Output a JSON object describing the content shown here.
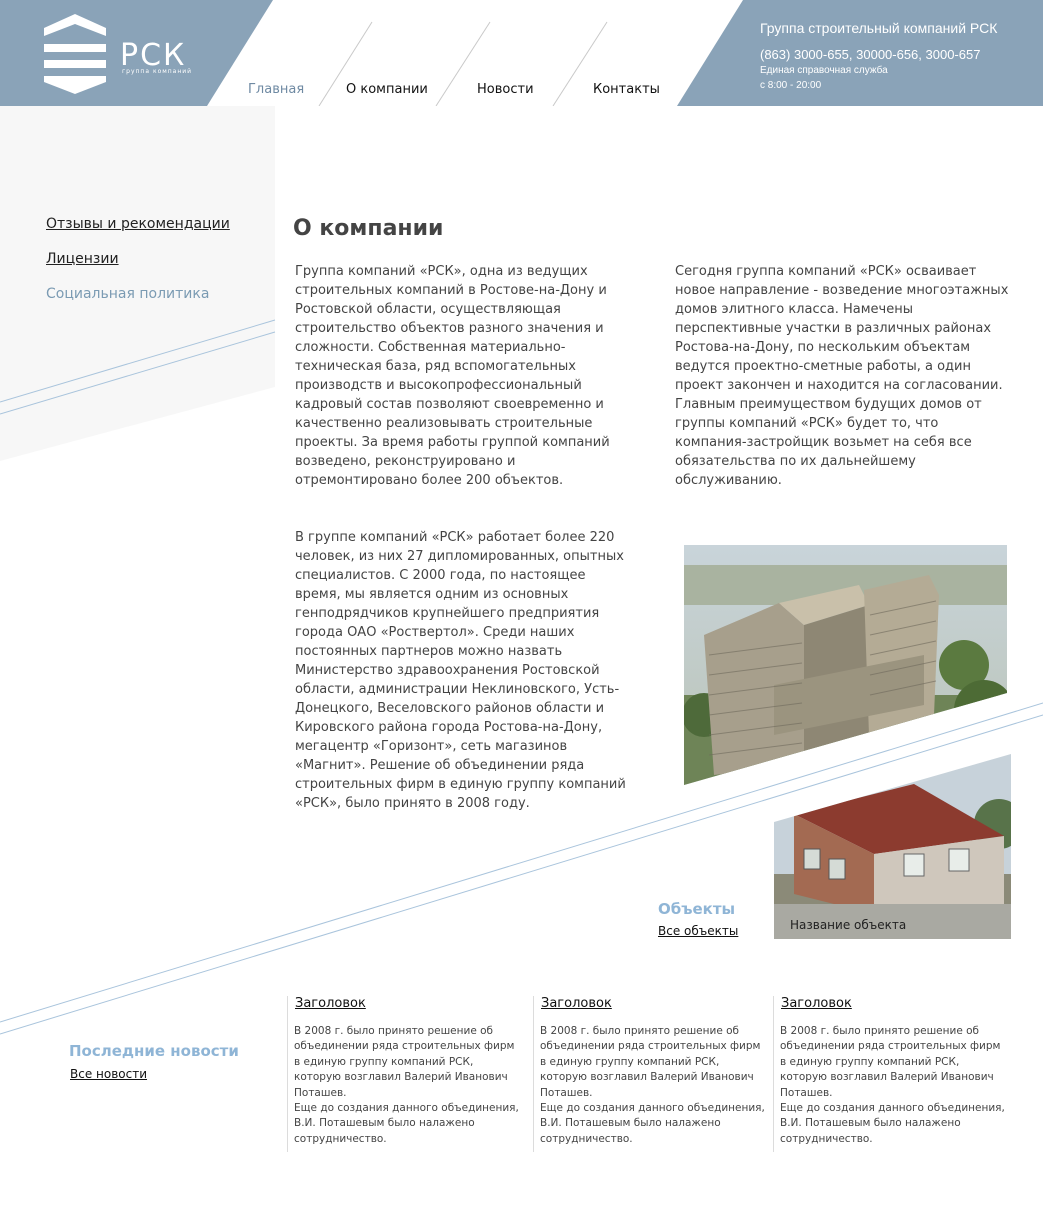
{
  "header": {
    "logo_text": "РСК",
    "logo_sub": "группа компаний",
    "nav": [
      {
        "label": "Главная",
        "active": true
      },
      {
        "label": "О компании",
        "active": false
      },
      {
        "label": "Новости",
        "active": false
      },
      {
        "label": "Контакты",
        "active": false
      }
    ],
    "company_title": "Группа строительный компаний РСК",
    "phones": "(863) 3000-655, 30000-656, 3000-657",
    "service": "Единая справочная служба",
    "hours": "с 8:00 - 20:00"
  },
  "colors": {
    "header_blue": "#8aa3b8",
    "accent_light_blue": "#8fb5d6",
    "muted_link": "#7b9bb3"
  },
  "sidebar": {
    "items": [
      {
        "label": "Отзывы и рекомендации"
      },
      {
        "label": "Лицензии"
      },
      {
        "label": "Социальная политика"
      }
    ]
  },
  "main": {
    "title": "О компании",
    "paragraphs": [
      "Группа компаний «РСК», одна из ведущих строительных компаний в Ростове-на-Дону и Ростовской области, осуществляющая строительство объектов разного значения и сложности. Собственная материально-техническая база, ряд вспомогательных производств и высокопрофессиональный кадровый состав позволяют своевременно и качественно реализовывать строительные проекты. За время работы группой компаний возведено, реконструировано и отремонтировано более 200 объектов.",
      "В группе компаний «РСК» работает более 220 человек, из них 27 дипломированных, опытных специалистов. С 2000 года, по настоящее время, мы является одним из основных генподрядчиков крупнейшего предприятия города ОАО «Роствертол». Среди наших постоянных партнеров можно назвать Министерство здравоохранения Ростовской области, администрации Неклиновского, Усть-Донецкого, Веселовского районов области и Кировского района города Ростова-на-Дону, мегацентр «Горизонт», сеть магазинов «Магнит». Решение об объединении ряда строительных фирм в единую группу компаний «РСК», было принято в 2008 году.",
      "Сегодня группа компаний «РСК» осваивает новое направление - возведение многоэтажных домов элитного класса. Намечены перспективные участки в различных районах Ростова-на-Дону, по нескольким объектам ведутся проектно-сметные работы, а один проект закончен и находится на согласовании. Главным преимуществом будущих домов от группы компаний «РСК» будет то, что компания-застройщик возьмет на себя все обязательства по их дальнейшему обслуживанию."
    ]
  },
  "objects": {
    "title": "Объекты",
    "all_link": "Все объекты",
    "caption": "Название объекта"
  },
  "news": {
    "title": "Последние новости",
    "all_link": "Все новости",
    "items": [
      {
        "heading": "Заголовок",
        "body": "В 2008 г. было принято решение об объединении ряда строительных фирм в единую группу компаний РСК, которую возглавил Валерий Иванович Поташев.\nЕще до создания данного объединения, В.И. Поташевым было налажено сотрудничество."
      },
      {
        "heading": "Заголовок",
        "body": "В 2008 г. было принято решение об объединении ряда строительных фирм в единую группу компаний РСК, которую возглавил Валерий Иванович Поташев.\nЕще до создания данного объединения, В.И. Поташевым было налажено сотрудничество."
      },
      {
        "heading": "Заголовок",
        "body": "В 2008 г. было принято решение об объединении ряда строительных фирм в единую группу компаний РСК, которую возглавил Валерий Иванович Поташев.\nЕще до создания данного объединения, В.И. Поташевым было налажено сотрудничество."
      }
    ]
  }
}
